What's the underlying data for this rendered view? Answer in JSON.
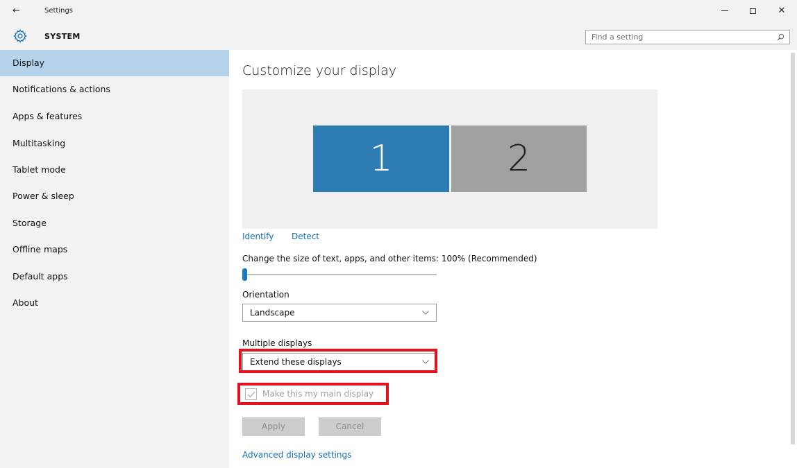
{
  "window": {
    "title": "Settings",
    "back_glyph": "←",
    "minimize_label": "minimize",
    "maximize_label": "maximize",
    "close_glyph": "✕"
  },
  "header": {
    "icon": "gear-icon",
    "title": "SYSTEM",
    "search": {
      "placeholder": "Find a setting",
      "value": "",
      "icon": "search-icon"
    }
  },
  "sidebar": {
    "items": [
      {
        "label": "Display",
        "active": true
      },
      {
        "label": "Notifications & actions",
        "active": false
      },
      {
        "label": "Apps & features",
        "active": false
      },
      {
        "label": "Multitasking",
        "active": false
      },
      {
        "label": "Tablet mode",
        "active": false
      },
      {
        "label": "Power & sleep",
        "active": false
      },
      {
        "label": "Storage",
        "active": false
      },
      {
        "label": "Offline maps",
        "active": false
      },
      {
        "label": "Default apps",
        "active": false
      },
      {
        "label": "About",
        "active": false
      }
    ]
  },
  "main": {
    "title": "Customize your display",
    "monitors": [
      {
        "label": "1",
        "selected": true
      },
      {
        "label": "2",
        "selected": false
      }
    ],
    "identify_label": "Identify",
    "detect_label": "Detect",
    "scale": {
      "label": "Change the size of text, apps, and other items: 100% (Recommended)",
      "value_percent": 100,
      "slider_position": 0
    },
    "orientation": {
      "label": "Orientation",
      "value": "Landscape"
    },
    "multiple_displays": {
      "label": "Multiple displays",
      "value": "Extend these displays"
    },
    "main_display_checkbox": {
      "label": "Make this my main display",
      "checked": true,
      "disabled": true
    },
    "apply_label": "Apply",
    "cancel_label": "Cancel",
    "advanced_link": "Advanced display settings"
  },
  "colors": {
    "accent": "#1170b5",
    "sidebar_bg": "#f2f2f2",
    "sidebar_active": "#b4d3ea",
    "monitor_primary": "#2d7db3",
    "monitor_secondary": "#a0a0a0",
    "highlight": "#e8101a"
  }
}
